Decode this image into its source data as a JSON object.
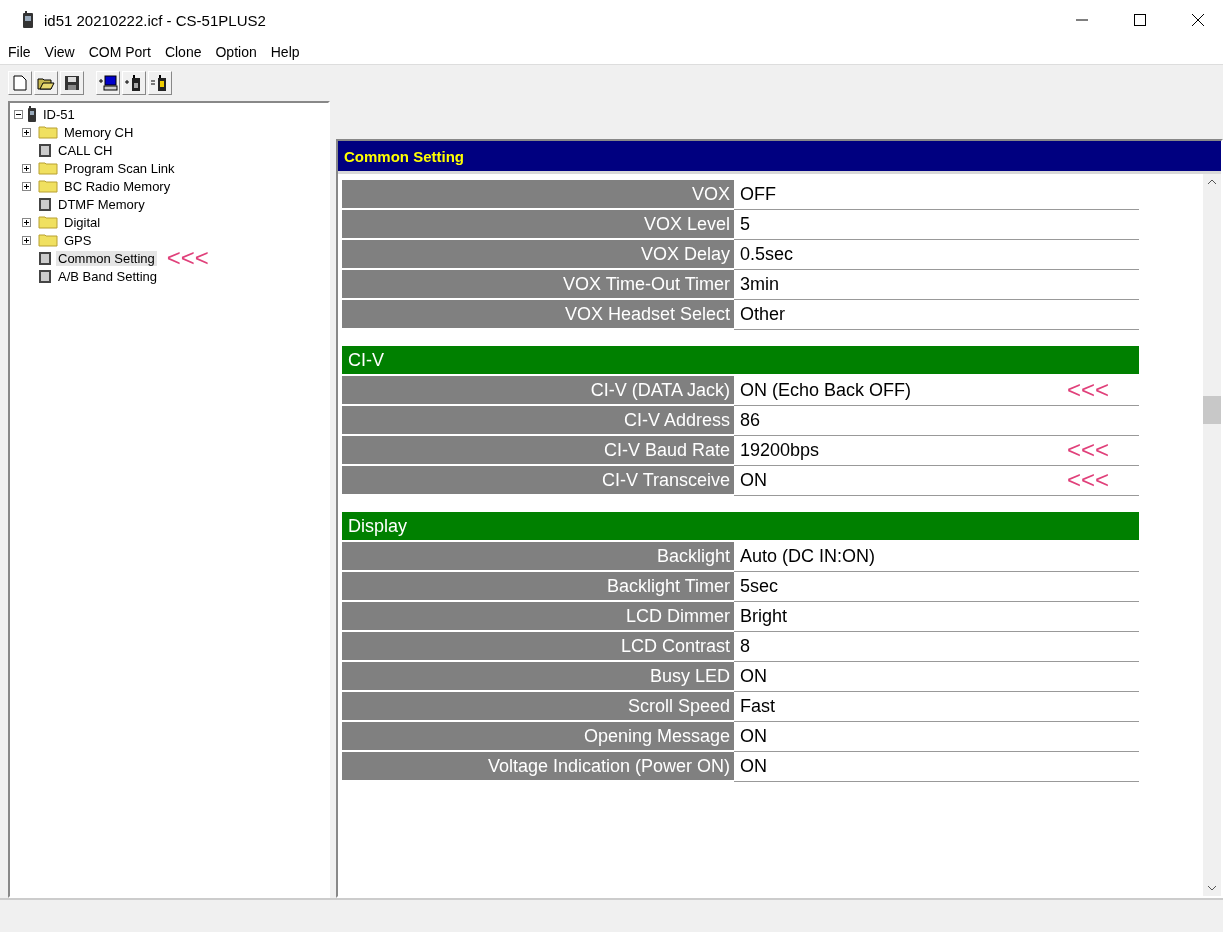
{
  "window": {
    "title": "id51 20210222.icf - CS-51PLUS2"
  },
  "menu": [
    "File",
    "View",
    "COM Port",
    "Clone",
    "Option",
    "Help"
  ],
  "tree": {
    "label": "ID-51",
    "expanded": true,
    "selected": false,
    "children": [
      {
        "label": "Memory CH",
        "kind": "folder",
        "expanded": false,
        "selected": false
      },
      {
        "label": "CALL CH",
        "kind": "page",
        "selected": false
      },
      {
        "label": "Program Scan Link",
        "kind": "folder",
        "expanded": false,
        "selected": false
      },
      {
        "label": "BC Radio Memory",
        "kind": "folder",
        "expanded": false,
        "selected": false
      },
      {
        "label": "DTMF Memory",
        "kind": "page",
        "selected": false
      },
      {
        "label": "Digital",
        "kind": "folder",
        "expanded": false,
        "selected": false
      },
      {
        "label": "GPS",
        "kind": "folder",
        "expanded": false,
        "selected": false
      },
      {
        "label": "Common Setting",
        "kind": "page",
        "selected": true,
        "note": "<<<"
      },
      {
        "label": "A/B Band Setting",
        "kind": "page",
        "selected": false
      }
    ]
  },
  "panel": {
    "title": "Common Setting",
    "sections": [
      {
        "rows": [
          {
            "label": "VOX",
            "value": "OFF"
          },
          {
            "label": "VOX Level",
            "value": "5"
          },
          {
            "label": "VOX Delay",
            "value": "0.5sec"
          },
          {
            "label": "VOX Time-Out Timer",
            "value": "3min"
          },
          {
            "label": "VOX Headset Select",
            "value": "Other"
          }
        ]
      },
      {
        "title": "CI-V",
        "rows": [
          {
            "label": "CI-V (DATA Jack)",
            "value": "ON (Echo Back OFF)",
            "note": "<<<"
          },
          {
            "label": "CI-V Address",
            "value": "86"
          },
          {
            "label": "CI-V Baud Rate",
            "value": "19200bps",
            "note": "<<<"
          },
          {
            "label": "CI-V Transceive",
            "value": "ON",
            "note": "<<<"
          }
        ]
      },
      {
        "title": "Display",
        "rows": [
          {
            "label": "Backlight",
            "value": "Auto (DC IN:ON)"
          },
          {
            "label": "Backlight Timer",
            "value": "5sec"
          },
          {
            "label": "LCD Dimmer",
            "value": "Bright"
          },
          {
            "label": "LCD Contrast",
            "value": "8"
          },
          {
            "label": "Busy LED",
            "value": "ON"
          },
          {
            "label": "Scroll Speed",
            "value": "Fast"
          },
          {
            "label": "Opening Message",
            "value": "ON"
          },
          {
            "label": "Voltage Indication (Power ON)",
            "value": "ON"
          }
        ]
      }
    ]
  }
}
